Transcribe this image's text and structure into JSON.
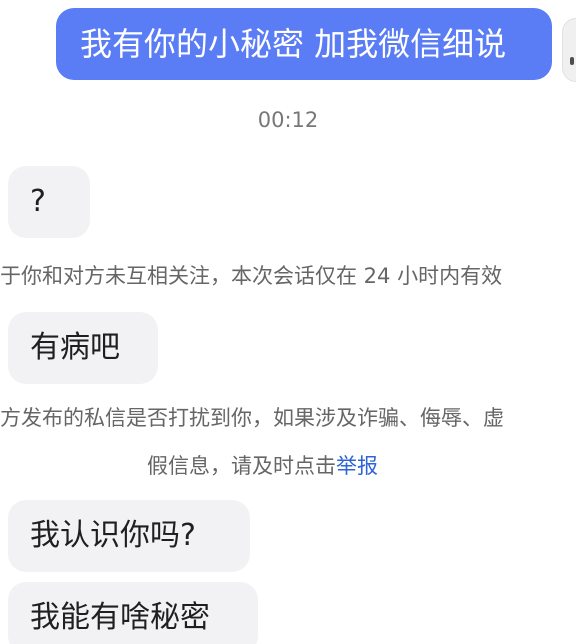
{
  "chat": {
    "outgoing_message": "我有你的小秘密 加我微信细说",
    "timestamp": "00:12",
    "messages": [
      {
        "text": "?"
      },
      {
        "text": "有病吧"
      },
      {
        "text": "我认识你吗?"
      },
      {
        "text": "我能有啥秘密"
      }
    ],
    "notices": {
      "mutual_follow": "于你和对方未互相关注，本次会话仅在 24 小时内有效",
      "harassment_line1": "方发布的私信是否打扰到你，如果涉及诈骗、侮辱、虚",
      "harassment_line2_prefix": "假信息，请及时点击",
      "harassment_link": "举报"
    }
  }
}
